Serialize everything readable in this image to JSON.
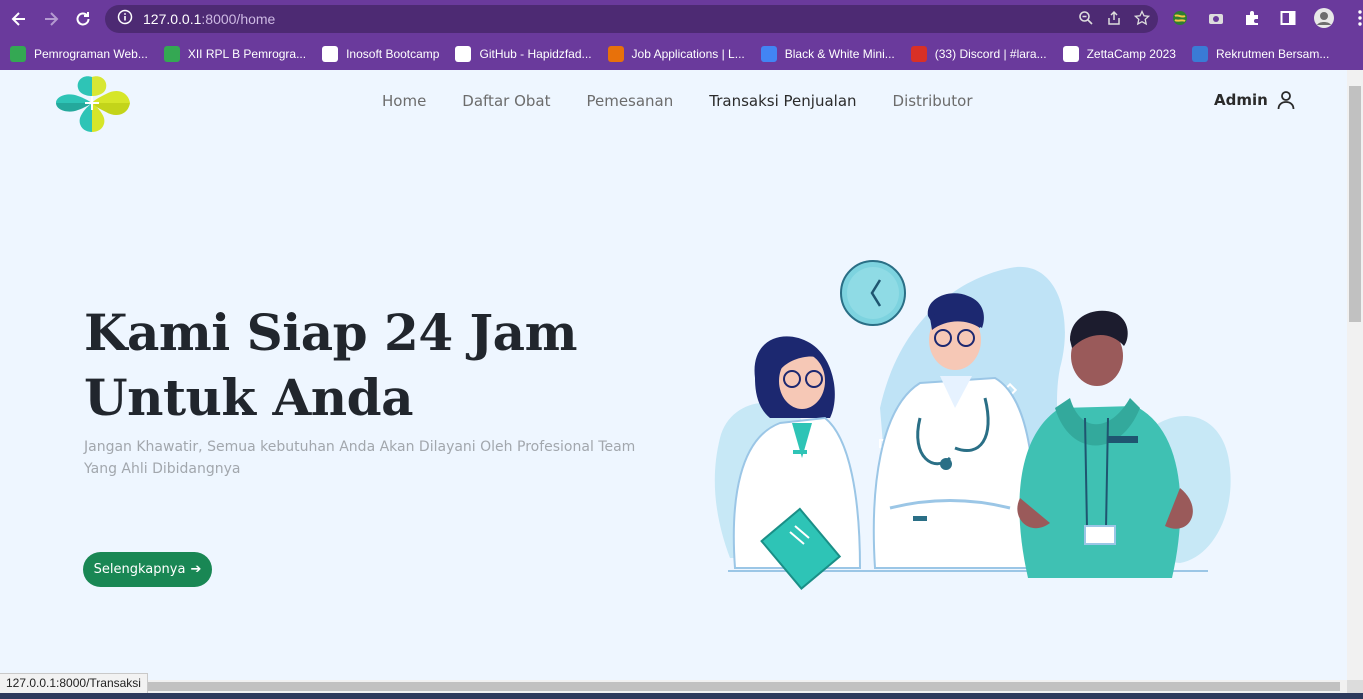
{
  "browser": {
    "url_host": "127.0.0.1",
    "url_rest": ":8000/home",
    "bookmarks": [
      {
        "label": "Pemrograman Web...",
        "color": "#34a853"
      },
      {
        "label": "XII RPL B Pemrogra...",
        "color": "#34a853"
      },
      {
        "label": "Inosoft Bootcamp",
        "color": "#ffffff"
      },
      {
        "label": "GitHub - Hapidzfad...",
        "color": "#ffffff"
      },
      {
        "label": "Job Applications | L...",
        "color": "#e8710a"
      },
      {
        "label": "Black & White Mini...",
        "color": "#4285f4"
      },
      {
        "label": "(33) Discord | #lara...",
        "color": "#d93025"
      },
      {
        "label": "ZettaCamp 2023",
        "color": "#ffffff"
      },
      {
        "label": "Rekrutmen Bersam...",
        "color": "#3a7bd5"
      }
    ],
    "status_text": "127.0.0.1:8000/Transaksi"
  },
  "nav": {
    "items": [
      "Home",
      "Daftar Obat",
      "Pemesanan",
      "Transaksi Penjualan",
      "Distributor"
    ],
    "active_index": 3,
    "admin_label": "Admin"
  },
  "hero": {
    "title_line1": "Kami Siap 24 Jam",
    "title_line2": "Untuk Anda",
    "subtitle_line1": "Jangan Khawatir, Semua kebutuhan Anda Akan Dilayani Oleh Profesional Team",
    "subtitle_line2": "Yang Ahli Dibidangnya",
    "cta_label": "Selengkapnya",
    "cta_arrow": "➔"
  },
  "colors": {
    "browser_purple": "#6a3a9c",
    "page_bg": "#eef6ff",
    "cta_green": "#198754",
    "logo_teal": "#2ec4b6",
    "logo_lime": "#d6e629"
  }
}
